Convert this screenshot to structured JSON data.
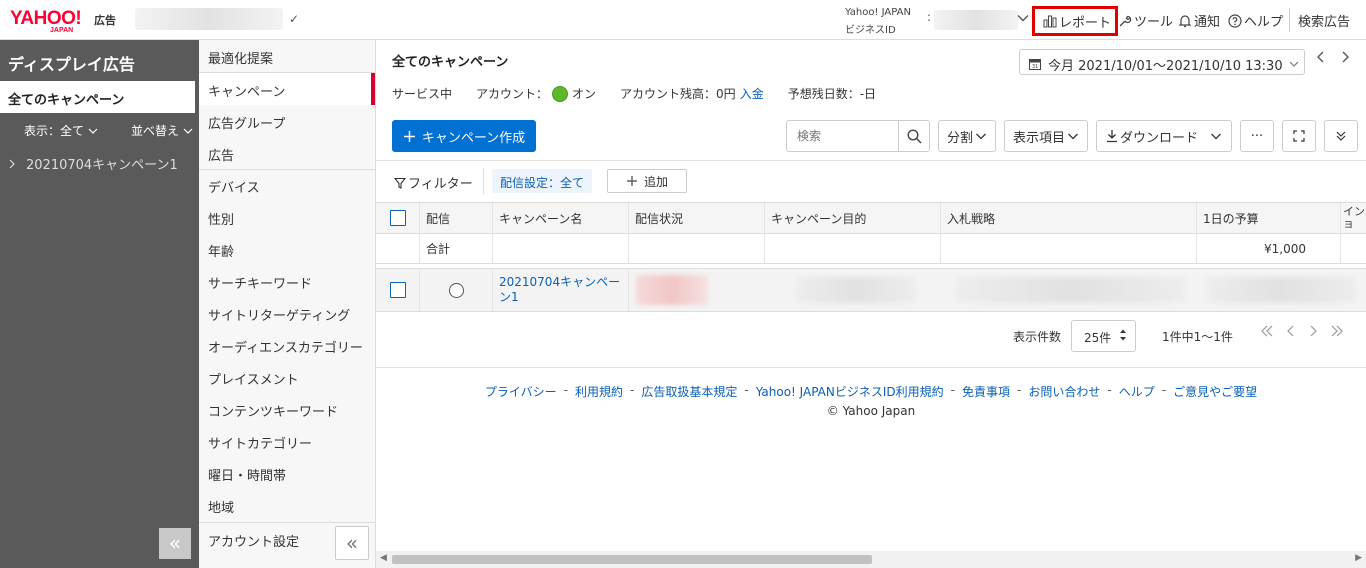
{
  "header": {
    "logo_main": "YAHOO!",
    "logo_sub": "JAPAN",
    "logo_product": "広告",
    "account_check": "✓",
    "business_label_1": "Yahoo! JAPAN",
    "business_label_2": "ビジネスID",
    "business_colon": ":",
    "links": {
      "report": "レポート",
      "tool": "ツール",
      "notice": "通知",
      "help": "ヘルプ",
      "search_ads": "検索広告"
    },
    "highlight_color": "#e00000"
  },
  "sidebar": {
    "title": "ディスプレイ広告",
    "all_campaigns": "全てのキャンペーン",
    "filter": "表示：全て",
    "sort": "並べ替え",
    "campaign_item": "20210704キャンペーン1",
    "collapse_glyph": "«"
  },
  "nav2": {
    "items": [
      "最適化提案",
      "キャンペーン",
      "広告グループ",
      "広告",
      "デバイス",
      "性別",
      "年齢",
      "サーチキーワード",
      "サイトリターゲティング",
      "オーディエンスカテゴリー",
      "プレイスメント",
      "コンテンツキーワード",
      "サイトカテゴリー",
      "曜日・時間帯",
      "地域",
      "アカウント設定"
    ],
    "active_index": 1,
    "collapse_glyph": "«"
  },
  "main": {
    "title": "全てのキャンペーン",
    "date_range": "今月 2021/10/01～2021/10/10 13:30",
    "status": {
      "service": "サービス中",
      "account_label": "アカウント：",
      "account_state": "オン",
      "balance_label": "アカウント残高：0円",
      "deposit_link": "入金",
      "days_label": "予想残日数：-日"
    },
    "toolbar": {
      "create": "キャンペーン作成",
      "search_placeholder": "検索",
      "split": "分割",
      "columns": "表示項目",
      "download": "ダウンロード",
      "more": "···"
    },
    "filter": {
      "label": "フィルター",
      "chip": "配信設定：全て",
      "add": "追加"
    },
    "table": {
      "headers": [
        "配信",
        "キャンペーン名",
        "配信状況",
        "キャンペーン目的",
        "入札戦略",
        "1日の予算",
        "イン ショ"
      ],
      "summary": {
        "label": "合計",
        "budget": "¥1,000"
      },
      "rows": [
        {
          "name": "20210704キャンペーン1"
        }
      ]
    },
    "pager": {
      "label": "表示件数",
      "per_page": "25件",
      "count": "1件中1～1件"
    },
    "footer": {
      "links": [
        "プライバシー",
        "利用規約",
        "広告取扱基本規定",
        "Yahoo! JAPANビジネスID利用規約",
        "免責事項",
        "お問い合わせ",
        "ヘルプ",
        "ご意見やご要望"
      ],
      "copyright": "© Yahoo Japan"
    }
  }
}
